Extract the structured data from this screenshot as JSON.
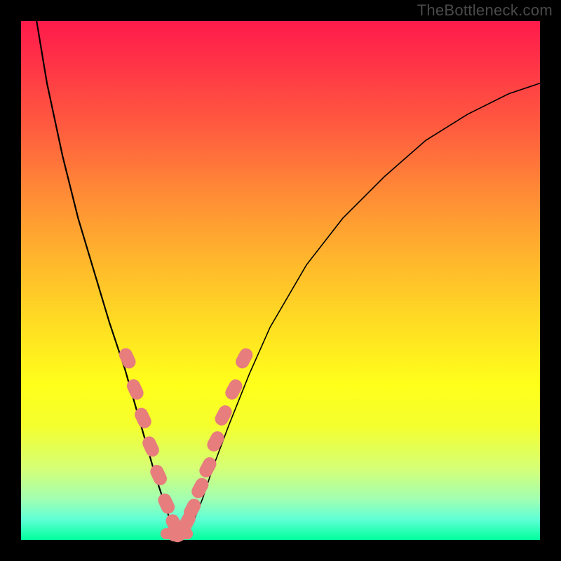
{
  "watermark": "TheBottleneck.com",
  "chart_data": {
    "type": "line",
    "title": "",
    "xlabel": "",
    "ylabel": "",
    "xlim": [
      0,
      100
    ],
    "ylim": [
      0,
      100
    ],
    "grid": false,
    "legend": false,
    "series": [
      {
        "name": "bottleneck-curve",
        "x": [
          3,
          5,
          8,
          11,
          14,
          17,
          20,
          22,
          24,
          26,
          28,
          29,
          30,
          31,
          33,
          35,
          37,
          40,
          44,
          48,
          55,
          62,
          70,
          78,
          86,
          94,
          100
        ],
        "y": [
          100,
          88,
          74,
          62,
          52,
          42,
          33,
          26,
          19,
          12,
          6,
          3,
          1,
          1,
          3,
          8,
          14,
          22,
          32,
          41,
          53,
          62,
          70,
          77,
          82,
          86,
          88
        ]
      }
    ],
    "markers": [
      {
        "name": "highlight-points-left",
        "x": [
          20.5,
          22,
          23.5,
          25,
          26.5,
          28,
          29.5
        ],
        "y": [
          35,
          29,
          23.5,
          18,
          12.5,
          7,
          3
        ]
      },
      {
        "name": "highlight-points-right",
        "x": [
          30.5,
          32,
          33,
          34.5,
          36,
          37.5,
          39,
          41,
          43
        ],
        "y": [
          1.5,
          3.5,
          6,
          10,
          14,
          19,
          24,
          29,
          35
        ]
      },
      {
        "name": "highlight-points-bottom",
        "x": [
          28.5,
          30,
          31.5
        ],
        "y": [
          1.2,
          0.8,
          1.2
        ]
      }
    ],
    "gradient_colors": {
      "top": "#ff1a4b",
      "mid": "#ffff1a",
      "bottom": "#00ff9c"
    },
    "marker_color": "#e77d7d",
    "line_color": "#000000"
  }
}
